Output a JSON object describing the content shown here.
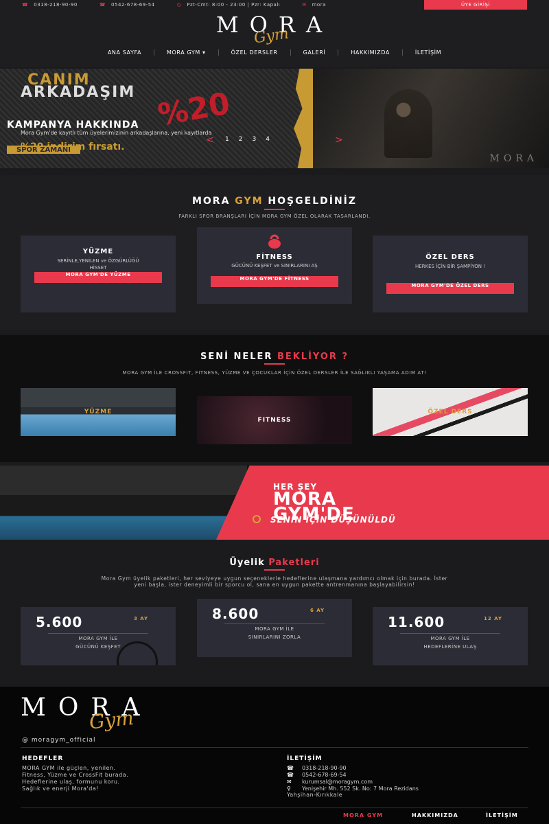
{
  "topbar": {
    "phone1": "0318-218-90-90",
    "phone2": "0542-678-69-54",
    "hours": "Pzt-Cmt: 8:00 - 23:00 | Pzr: Kapalı",
    "email_partial": "mora",
    "member_button": "ÜYE GİRİŞİ"
  },
  "header": {
    "logo_text": "MORA",
    "logo_script": "Gym",
    "nav": [
      "ANA SAYFA",
      "MORA GYM ▾",
      "ÖZEL DERSLER",
      "GALERİ",
      "HAKKIMIZDA",
      "İLETİŞİM"
    ]
  },
  "hero": {
    "line1": "CANIM",
    "line2": "ARKADAŞIM",
    "percent": "%20",
    "title": "KAMPANYA HAKKINDA",
    "text": "Mora Gym'de kayıtlı tüm üyelerimizinin arkadaşlarına, yeni kayıtlarda",
    "sale": "%20 indirim fırsatı.",
    "tag": "SPOR ZAMANI",
    "pages": [
      "1",
      "2",
      "3",
      "4"
    ],
    "prev": "<",
    "next": ">",
    "ghost_logo": "MORA"
  },
  "welcome": {
    "title_a": "MORA ",
    "title_b": "GYM",
    "title_c": " HOŞGELDİNİZ",
    "subtitle": "FARKLI SPOR BRANŞLARI İÇİN MORA GYM ÖZEL OLARAK TASARLANDI.",
    "cards": [
      {
        "title": "YÜZME",
        "desc": "SERİNLE,YENİLEN ve ÖZGÜRLÜĞÜ HİSSET",
        "button": "MORA GYM'DE YÜZME"
      },
      {
        "title": "FİTNESS",
        "desc": "GÜCÜNÜ KEŞFET ve SINIRLARINI AŞ",
        "button": "MORA GYM'DE FİTNESS"
      },
      {
        "title": "ÖZEL DERS",
        "desc": "HERKES İÇİN BİR ŞAMPİYON !",
        "button": "MORA GYM'DE ÖZEL DERS"
      }
    ]
  },
  "expect": {
    "title_a": "SENİ NELER ",
    "title_b": "BEKLİYOR ?",
    "subtitle": "MORA GYM İLE CROSSFIT, FITNESS, YÜZME VE ÇOCUKLAR İÇİN ÖZEL DERSLER İLE SAĞLIKLI YAŞAMA ADIM AT!",
    "photos": [
      "YÜZME",
      "FITNESS",
      "ÖZEL DERS"
    ]
  },
  "banner": {
    "small": "HER ŞEY",
    "big1": "MORA",
    "big2": "GYM'DE",
    "tag": "SENİN İÇİN DÜŞÜNÜLDÜ"
  },
  "pricing": {
    "title_a": "Üyelik ",
    "title_b": "Paketleri",
    "text": "Mora Gym üyelik paketleri, her seviyeye uygun seçeneklerle hedeflerine ulaşmana yardımcı olmak için burada. İster yeni başla, ister deneyimli bir sporcu ol, sana en uygun pakette antrenmanına başlayabilirsin!",
    "plans": [
      {
        "price": "5.600",
        "period": "3 AY",
        "line1": "MORA GYM İLE",
        "line2": "GÜCÜNÜ KEŞFET"
      },
      {
        "price": "8.600",
        "period": "6 AY",
        "line1": "MORA GYM İLE",
        "line2": "SINIRLARINI ZORLA"
      },
      {
        "price": "11.600",
        "period": "12 AY",
        "line1": "MORA GYM İLE",
        "line2": "HEDEFLERİNE ULAŞ"
      }
    ]
  },
  "footer": {
    "logo_text": "MORA",
    "logo_script": "Gym",
    "instagram": "@ moragym_official",
    "goals_title": "HEDEFLER",
    "goals_text": [
      "MORA GYM ile güçlen, yenilen.",
      "Fitness, Yüzme ve CrossFit burada.",
      "Hedeflerine ulaş, formunu koru.",
      "Sağlık ve enerji Mora'da!"
    ],
    "contact_title": "İLETİŞİM",
    "phone1": "0318-218-90-90",
    "phone2": "0542-678-69-54",
    "email": "kurumsal@moragym.com",
    "address1": "Yenişehir Mh. 552 Sk. No: 7 Mora Rezidans",
    "address2": "Yahşihan-Kırıkkale",
    "nav": [
      "MORA GYM",
      "HAKKIMIZDA",
      "İLETİŞİM"
    ]
  },
  "colors": {
    "accent": "#e83a4c",
    "gold": "#d9a23a",
    "card": "#2b2c35"
  }
}
